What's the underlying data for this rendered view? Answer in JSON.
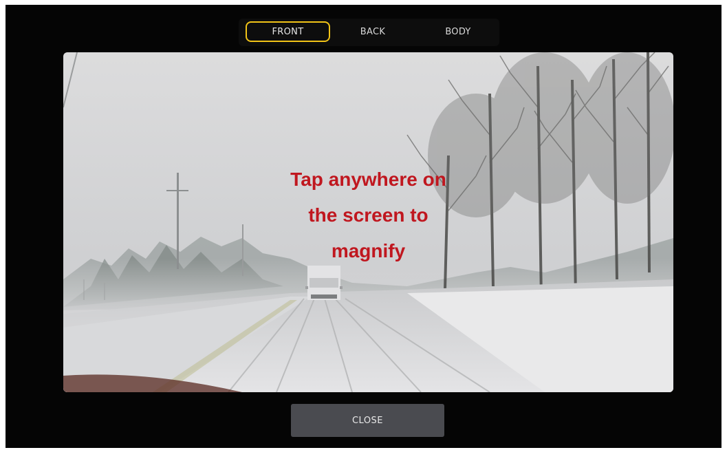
{
  "tabs": [
    {
      "label": "FRONT",
      "active": true
    },
    {
      "label": "BACK",
      "active": false
    },
    {
      "label": "BODY",
      "active": false
    }
  ],
  "viewer": {
    "hint_lines": [
      "Tap anywhere on",
      "the screen to",
      "magnify"
    ],
    "hint_color": "#c0171f"
  },
  "close_label": "CLOSE",
  "colors": {
    "background": "#050505",
    "active_tab_border": "#f2c417",
    "close_button": "#4a4b50"
  }
}
